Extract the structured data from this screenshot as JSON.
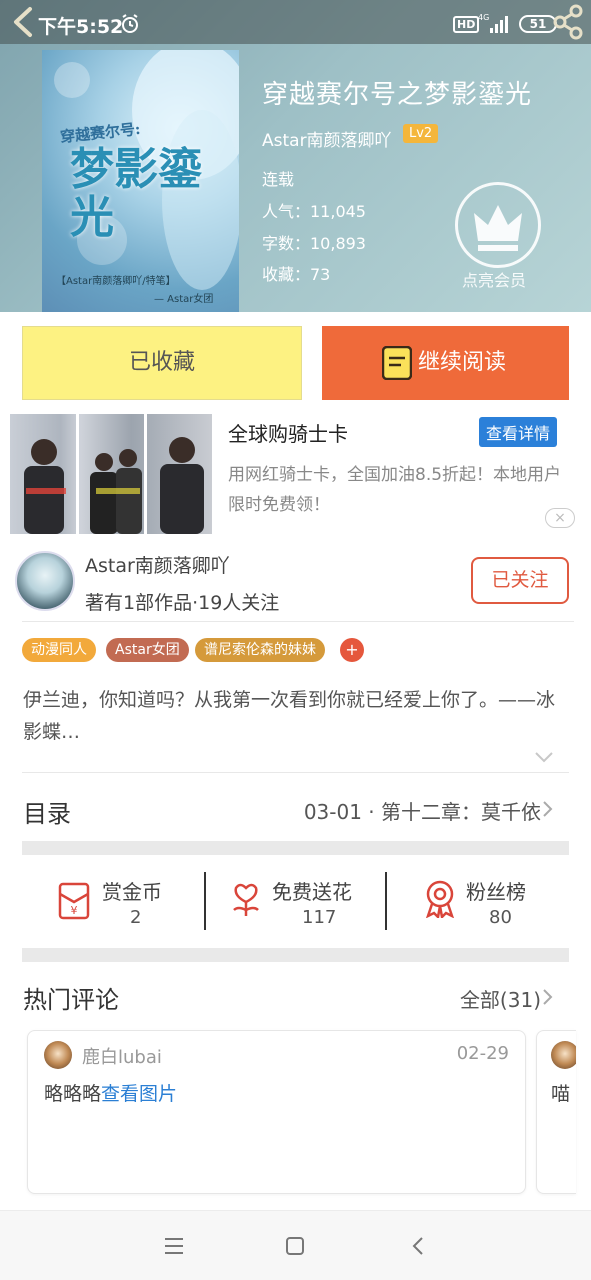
{
  "status_bar": {
    "time": "下午5:52",
    "network_hd": "HD",
    "network_type": "4G",
    "battery": "51"
  },
  "book": {
    "title": "穿越赛尔号之梦影鎏光",
    "author": "Astar南颜落卿吖",
    "author_level": "Lv2",
    "status": "连载",
    "popularity": "人气：11,045",
    "word_count": "字数：10,893",
    "favorites": "收藏：73",
    "vip_label": "点亮会员",
    "cover": {
      "top_text": "穿越赛尔号:",
      "main_text": "梦影鎏光",
      "byline": "【Astar南颜落卿吖/特笔】",
      "signature": "— Astar女团"
    }
  },
  "actions": {
    "favorited_label": "已收藏",
    "continue_label": "继续阅读"
  },
  "ad": {
    "title": "全球购骑士卡",
    "detail_button": "查看详情",
    "description": "用网红骑士卡，全国加油8.5折起！本地用户限时免费领！",
    "close": "×"
  },
  "author_card": {
    "name": "Astar南颜落卿吖",
    "works": "著有1部作品·19人关注",
    "follow_label": "已关注"
  },
  "tags": [
    {
      "label": "动漫同人",
      "color": "#f2a93b"
    },
    {
      "label": "Astar女团",
      "color": "#c26b52"
    },
    {
      "label": "谱尼索伦森的妹妹",
      "color": "#d59a3b"
    }
  ],
  "tag_add": "+",
  "intro": "伊兰迪，你知道吗？从我第一次看到你就已经爱上你了。——冰影蝶…",
  "directory": {
    "label": "目录",
    "latest": "03-01 · 第十二章：莫千依"
  },
  "stats": [
    {
      "label": "赏金币",
      "value": "2",
      "icon": "red-envelope-icon"
    },
    {
      "label": "免费送花",
      "value": "117",
      "icon": "flower-icon"
    },
    {
      "label": "粉丝榜",
      "value": "80",
      "icon": "medal-icon"
    }
  ],
  "comments": {
    "label": "热门评论",
    "all": "全部(31)",
    "items": [
      {
        "user": "鹿白lubai",
        "date": "02-29",
        "text": "略略略",
        "link": "查看图片"
      },
      {
        "text_peek": "喵"
      }
    ]
  },
  "colors": {
    "accent_orange": "#ef6a3a",
    "favorite_yellow": "#fdf282",
    "follow_red": "#e05a40",
    "link_blue": "#2b7fd4"
  }
}
